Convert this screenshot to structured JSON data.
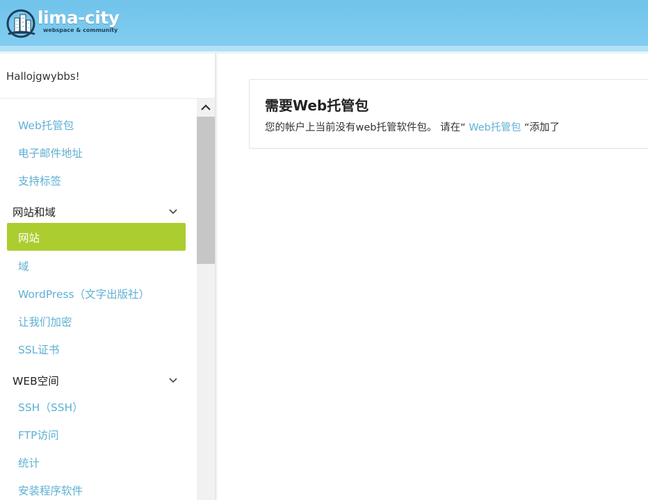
{
  "header": {
    "logo_text": "lima-city",
    "logo_sub": "webspace & community",
    "brand_color": "#7ccbee"
  },
  "sidebar": {
    "greeting": "Hallojgwybbs!",
    "items": [
      {
        "type": "link",
        "label": "Web托管包"
      },
      {
        "type": "link",
        "label": "电子邮件地址"
      },
      {
        "type": "link",
        "label": "支持标签"
      },
      {
        "type": "section",
        "label": "网站和域",
        "icon": "chevron-down-icon"
      },
      {
        "type": "active",
        "label": "网站",
        "color": "#abcd2f"
      },
      {
        "type": "link",
        "label": "域"
      },
      {
        "type": "link",
        "label": "WordPress（文字出版社）"
      },
      {
        "type": "link",
        "label": "让我们加密"
      },
      {
        "type": "link",
        "label": "SSL证书"
      },
      {
        "type": "section",
        "label": "WEB空间",
        "icon": "chevron-down-icon"
      },
      {
        "type": "link",
        "label": "SSH（SSH）"
      },
      {
        "type": "link",
        "label": "FTP访问"
      },
      {
        "type": "link",
        "label": "统计"
      },
      {
        "type": "link",
        "label": "安装程序软件"
      }
    ],
    "link_color": "#5fb0d5"
  },
  "main": {
    "card": {
      "title": "需要Web托管包",
      "text_before": "您的帐户上当前没有web托管软件包。 请在“",
      "link": " Web托管包 ",
      "text_after": "“添加了"
    }
  }
}
